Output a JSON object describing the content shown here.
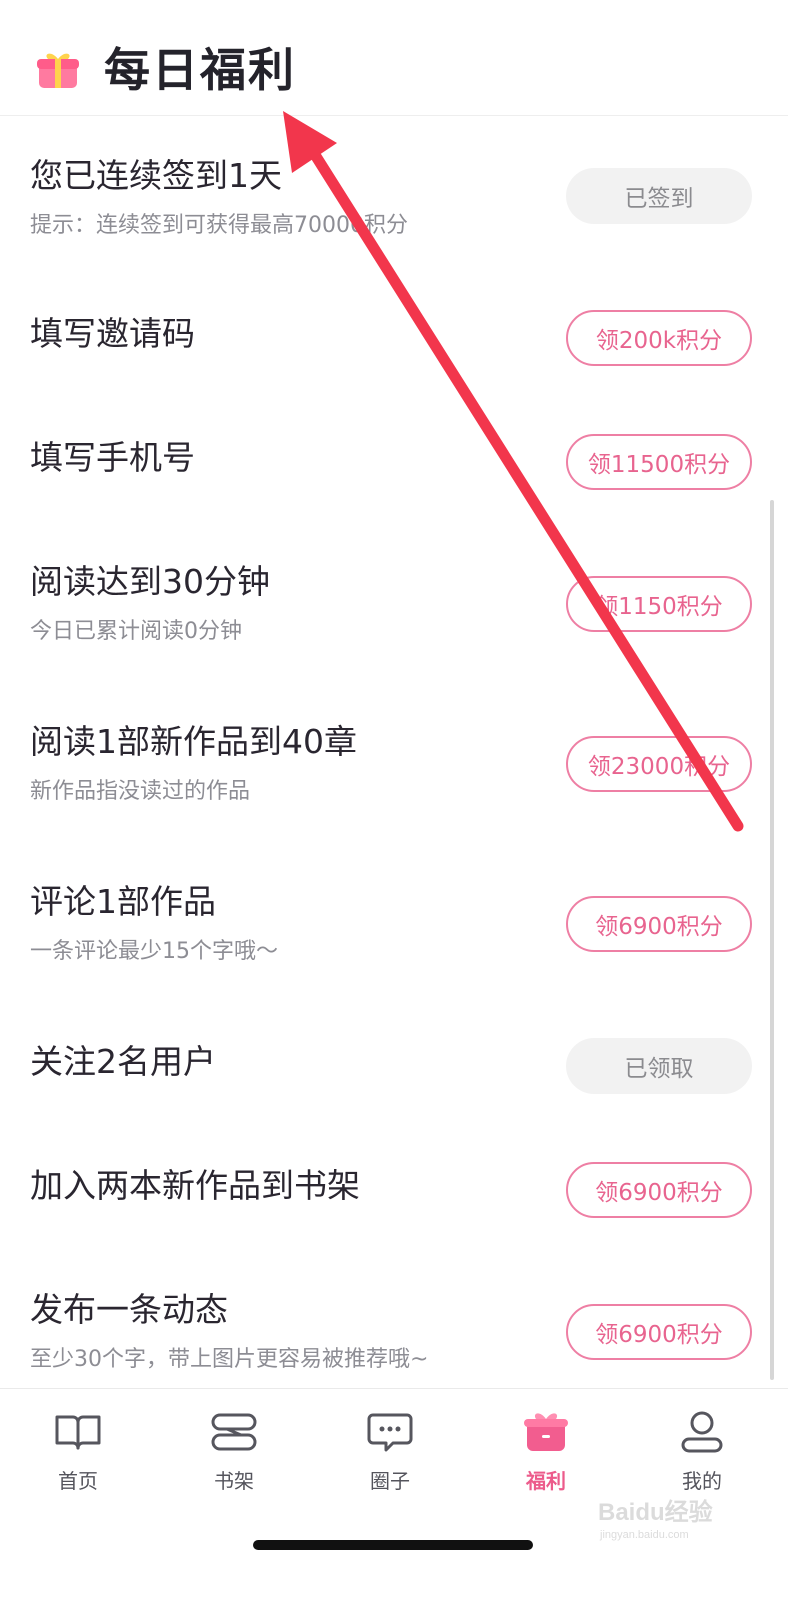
{
  "header": {
    "title": "每日福利",
    "icon": "gift-icon"
  },
  "colors": {
    "accent": "#ec5b8b",
    "claim_border": "#ee7fa4",
    "done_bg": "#f2f2f2",
    "annotation_arrow": "#f2364c"
  },
  "tasks": [
    {
      "title": "您已连续签到1天",
      "subtitle": "提示：连续签到可获得最高70000积分",
      "button": "已签到",
      "state": "done"
    },
    {
      "title": "填写邀请码",
      "subtitle": "",
      "button": "领200k积分",
      "state": "claim"
    },
    {
      "title": "填写手机号",
      "subtitle": "",
      "button": "领11500积分",
      "state": "claim"
    },
    {
      "title": "阅读达到30分钟",
      "subtitle": "今日已累计阅读0分钟",
      "button": "领1150积分",
      "state": "claim"
    },
    {
      "title": "阅读1部新作品到40章",
      "subtitle": "新作品指没读过的作品",
      "button": "领23000积分",
      "state": "claim"
    },
    {
      "title": "评论1部作品",
      "subtitle": "一条评论最少15个字哦～",
      "button": "领6900积分",
      "state": "claim"
    },
    {
      "title": "关注2名用户",
      "subtitle": "",
      "button": "已领取",
      "state": "done"
    },
    {
      "title": "加入两本新作品到书架",
      "subtitle": "",
      "button": "领6900积分",
      "state": "claim"
    },
    {
      "title": "发布一条动态",
      "subtitle": "至少30个字，带上图片更容易被推荐哦~",
      "button": "领6900积分",
      "state": "claim"
    }
  ],
  "tabbar": {
    "items": [
      {
        "label": "首页",
        "icon": "book-open-icon",
        "active": false
      },
      {
        "label": "书架",
        "icon": "bookshelf-icon",
        "active": false
      },
      {
        "label": "圈子",
        "icon": "chat-bubble-icon",
        "active": false
      },
      {
        "label": "福利",
        "icon": "gift-box-icon",
        "active": true
      },
      {
        "label": "我的",
        "icon": "user-icon",
        "active": false
      }
    ]
  },
  "watermark": {
    "text": "Baidu经验",
    "subtext": "jingyan.baidu.com"
  }
}
